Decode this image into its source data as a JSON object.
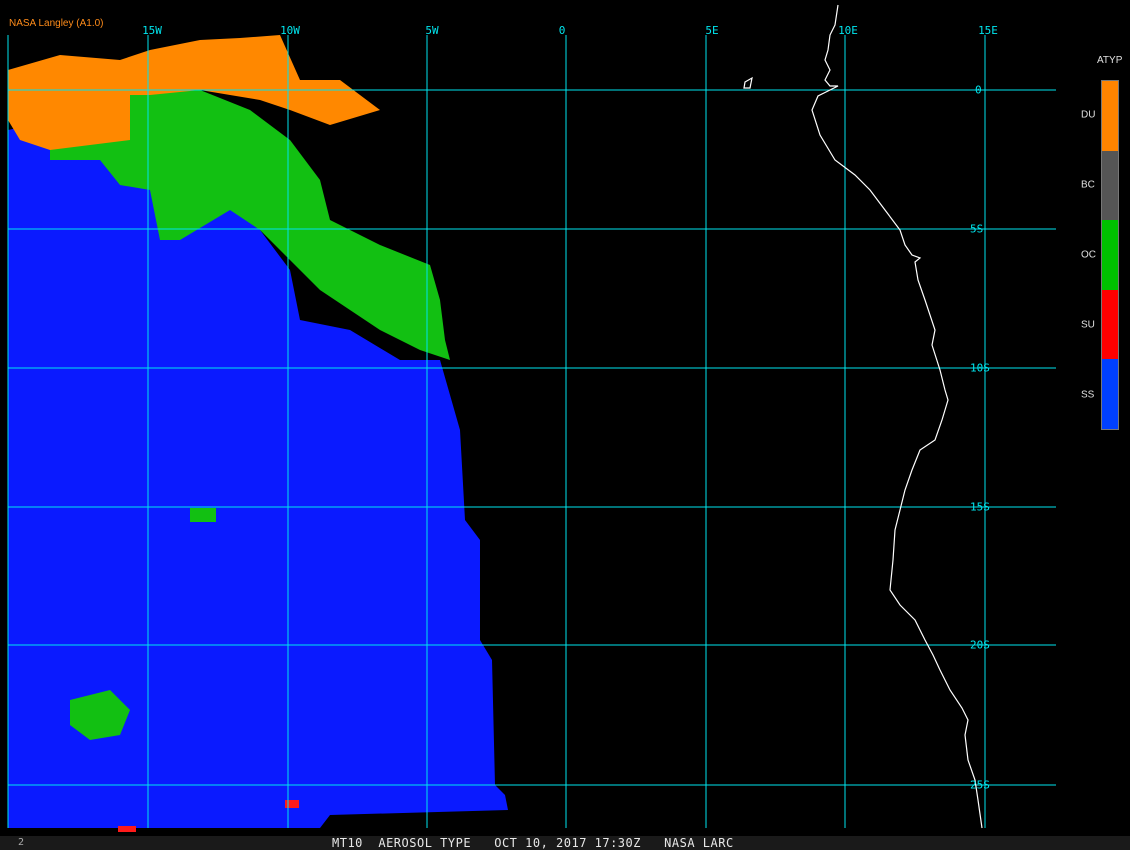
{
  "brand": "NASA Langley (A1.0)",
  "longitude_labels": [
    "15W",
    "10W",
    "5W",
    "0",
    "5E",
    "10E",
    "15E"
  ],
  "latitude_labels": [
    "0",
    "5S",
    "10S",
    "15S",
    "20S",
    "25S"
  ],
  "legend": {
    "title": "ATYP",
    "items": [
      {
        "label": "DU",
        "color": "#ff8400"
      },
      {
        "label": "BC",
        "color": "#555555"
      },
      {
        "label": "OC",
        "color": "#00c000"
      },
      {
        "label": "SU",
        "color": "#ff0000"
      },
      {
        "label": "SS",
        "color": "#0040ff"
      }
    ]
  },
  "footer": {
    "text": "MT10  AEROSOL TYPE   OCT 10, 2017 17:30Z   NASA LARC",
    "number": "2"
  },
  "colors": {
    "grid": "#00e5ee",
    "coastline": "#ffffff",
    "background": "#000000"
  }
}
